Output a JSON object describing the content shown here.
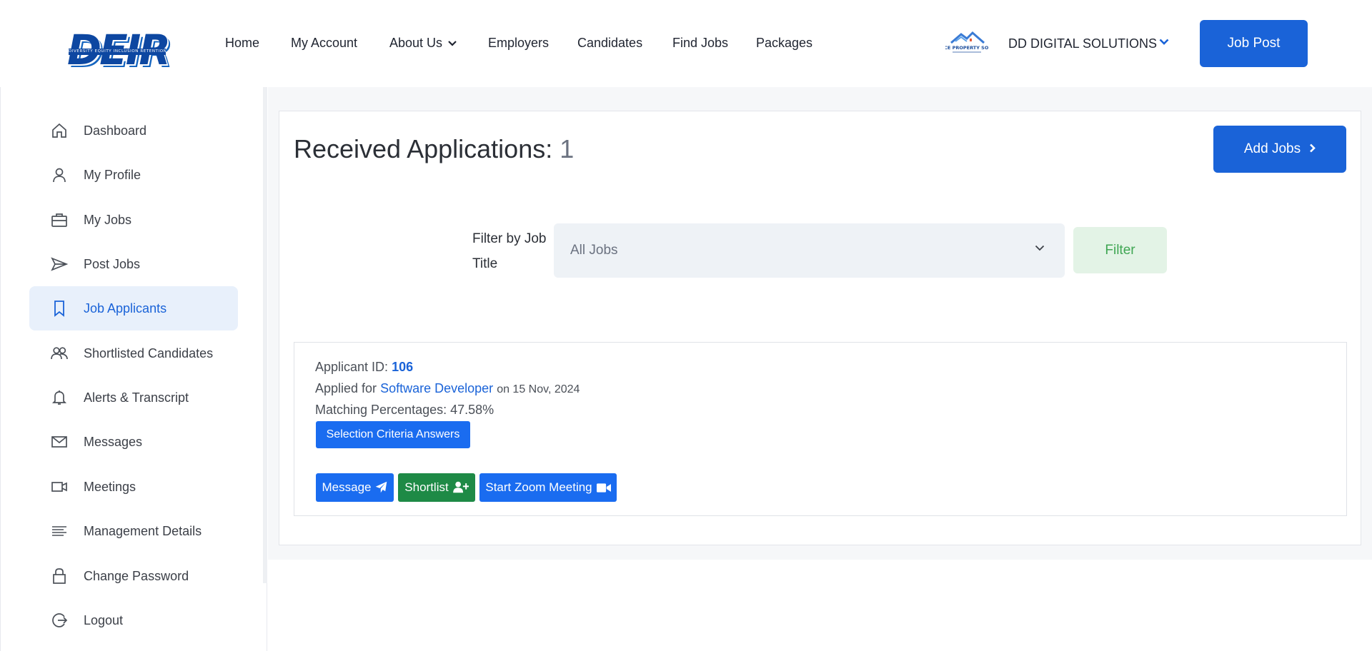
{
  "header": {
    "logo_text": "DEIR",
    "logo_tagline": "DIVERSITY EQUITY INCLUSION RETENTION",
    "nav": [
      {
        "label": "Home"
      },
      {
        "label": "My Account"
      },
      {
        "label": "About Us"
      },
      {
        "label": "Employers"
      },
      {
        "label": "Candidates"
      },
      {
        "label": "Find Jobs"
      },
      {
        "label": "Packages"
      }
    ],
    "company_logo_text": "ADVANCE PROPERTY SOLUTION",
    "company_name": "DD DIGITAL SOLUTIONS",
    "job_post_label": "Job Post"
  },
  "sidebar": {
    "items": [
      {
        "label": "Dashboard",
        "icon": "home-icon"
      },
      {
        "label": "My Profile",
        "icon": "user-icon"
      },
      {
        "label": "My Jobs",
        "icon": "briefcase-icon"
      },
      {
        "label": "Post Jobs",
        "icon": "send-icon"
      },
      {
        "label": "Job Applicants",
        "icon": "bookmark-icon",
        "active": true
      },
      {
        "label": "Shortlisted Candidates",
        "icon": "users-icon"
      },
      {
        "label": "Alerts & Transcript",
        "icon": "bell-icon"
      },
      {
        "label": "Messages",
        "icon": "mail-icon"
      },
      {
        "label": "Meetings",
        "icon": "video-icon"
      },
      {
        "label": "Management Details",
        "icon": "list-icon"
      },
      {
        "label": "Change Password",
        "icon": "lock-icon"
      },
      {
        "label": "Logout",
        "icon": "logout-icon"
      }
    ]
  },
  "main": {
    "title": "Received Applications:",
    "count": "1",
    "add_jobs_label": "Add Jobs",
    "filter_label": "Filter by Job Title",
    "filter_value": "All Jobs",
    "filter_button": "Filter",
    "applicant": {
      "id_label": "Applicant ID:",
      "id_value": "106",
      "applied_for_label": "Applied for",
      "job_title": "Software Developer",
      "date_text": "on 15 Nov, 2024",
      "matching_text": "Matching Percentages: 47.58%",
      "criteria_button": "Selection Criteria Answers",
      "message_button": "Message",
      "shortlist_button": "Shortlist",
      "zoom_button": "Start Zoom Meeting"
    }
  },
  "colors": {
    "primary": "#1a63d8",
    "success": "#1e8a46",
    "filter_bg": "#e3f3e6",
    "active_bg": "#e8f0fb"
  }
}
